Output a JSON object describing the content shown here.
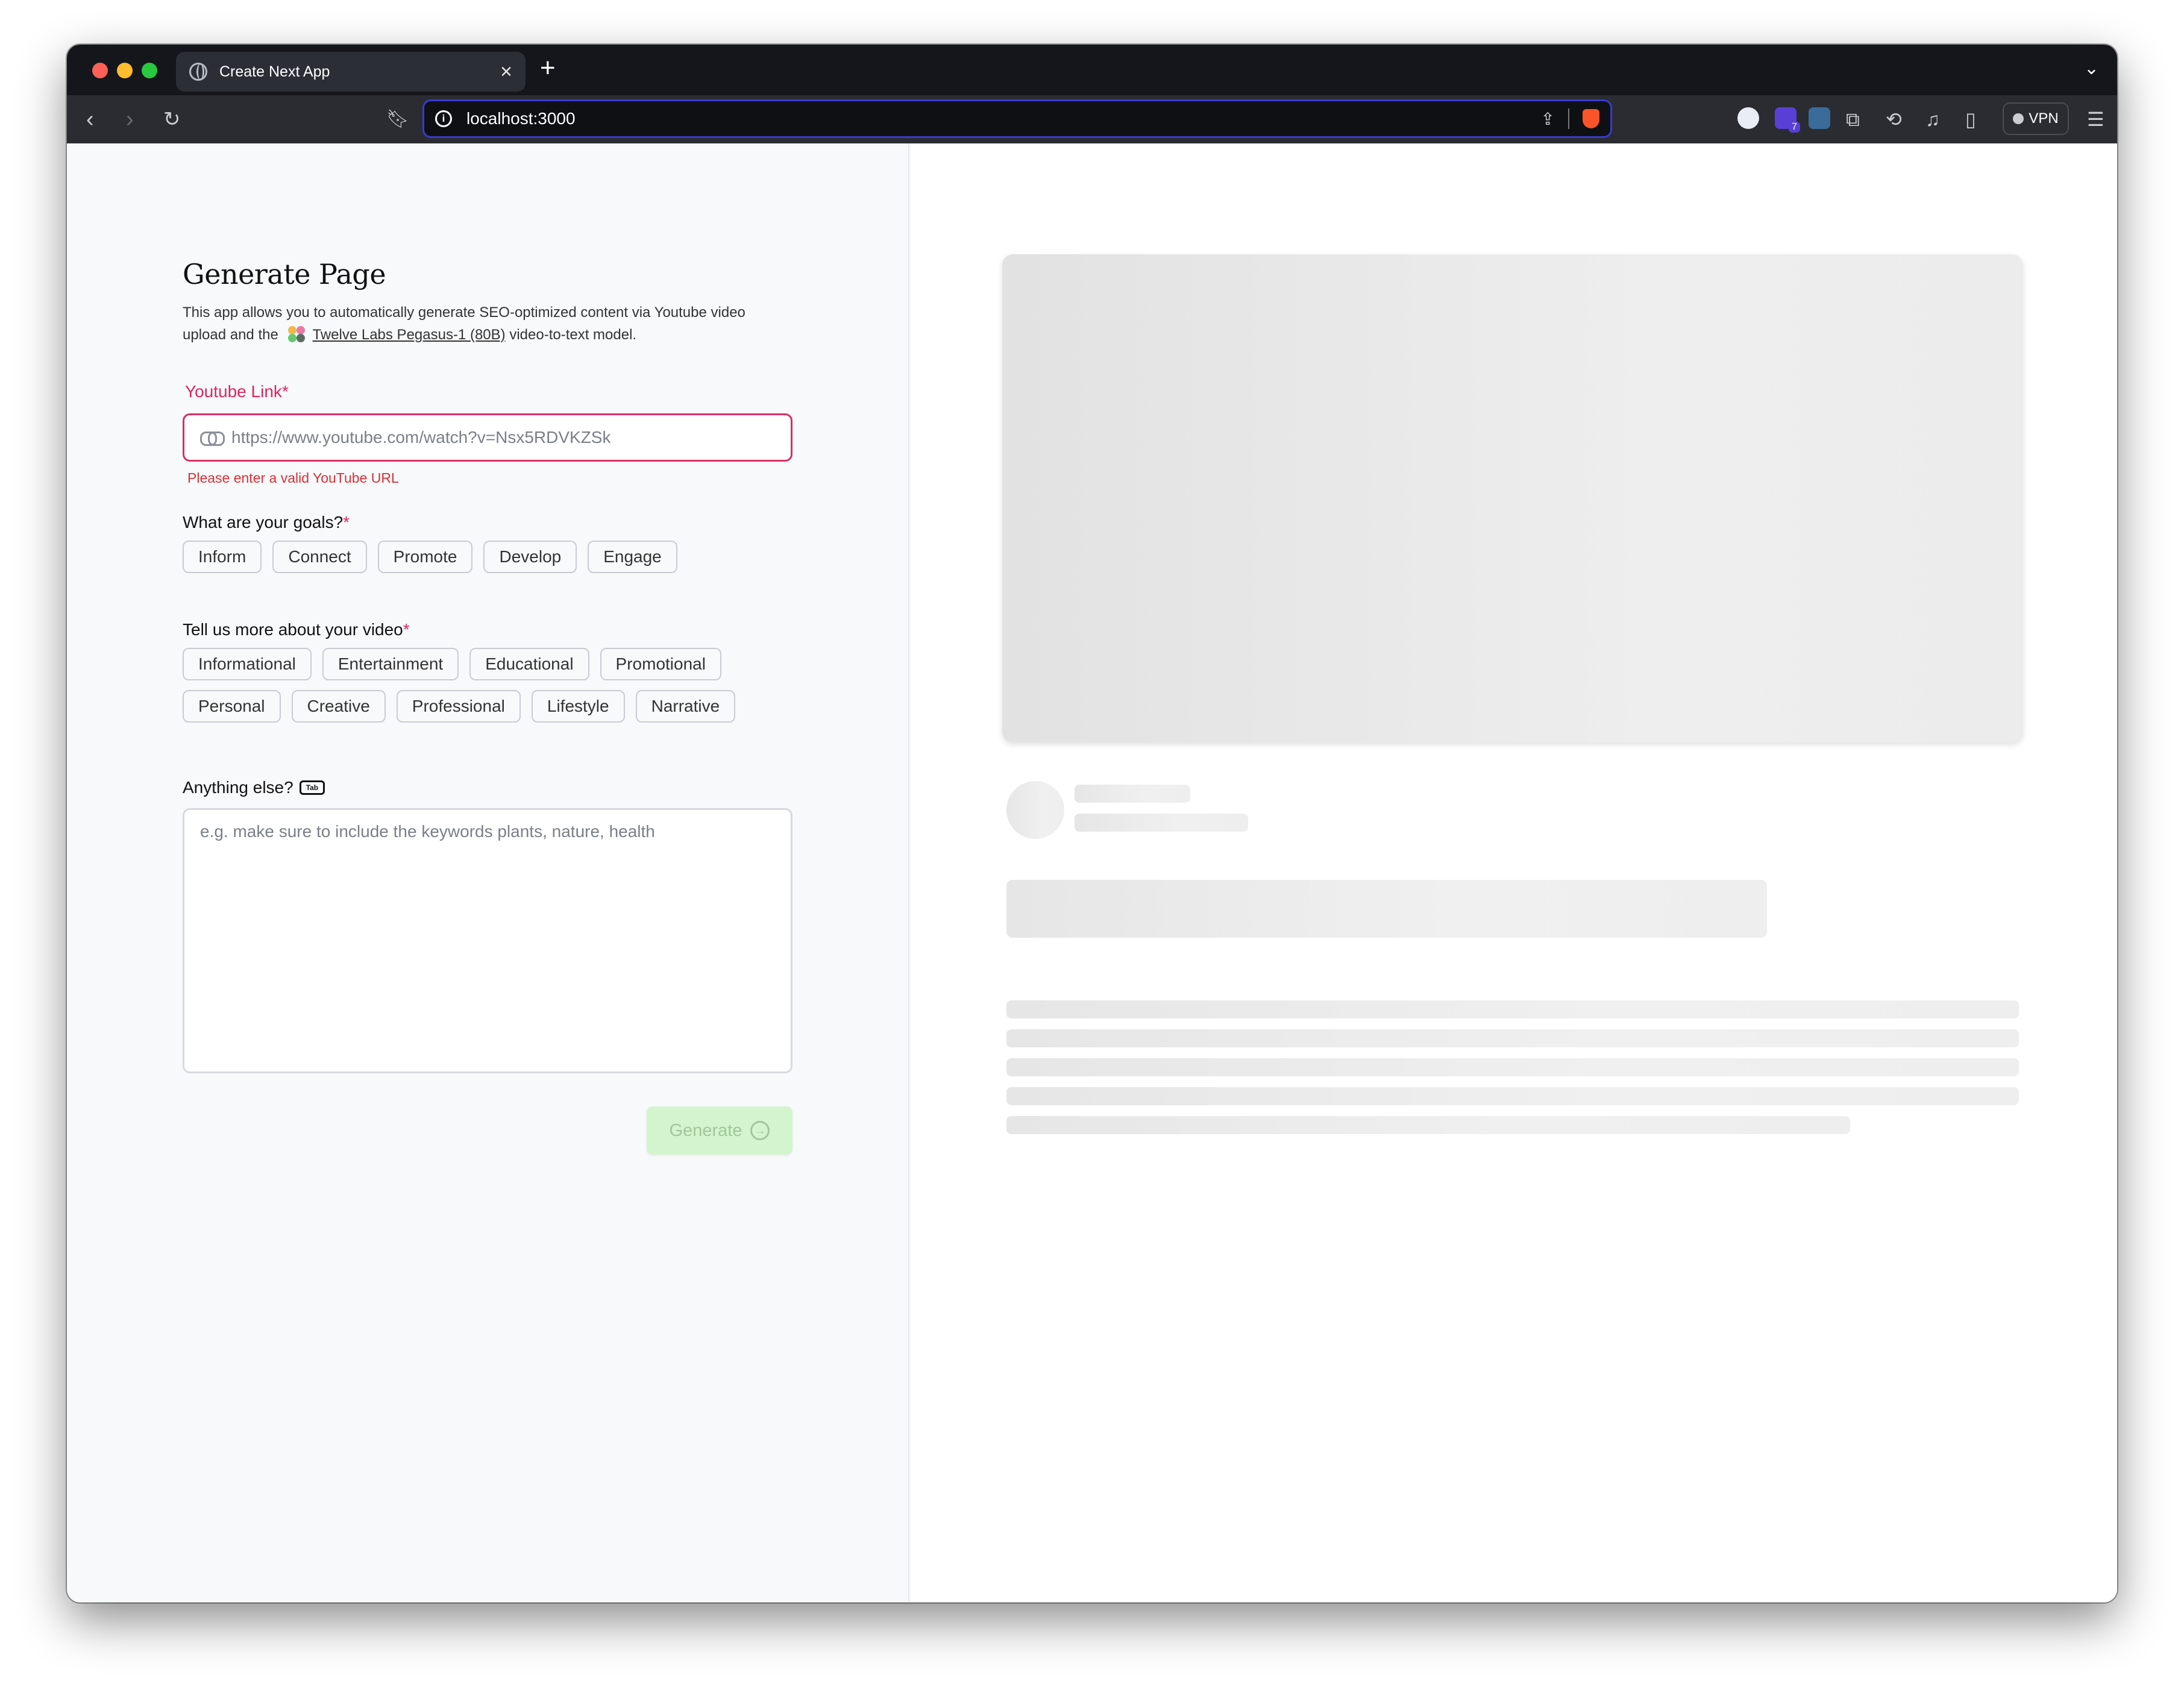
{
  "browser": {
    "tab_title": "Create Next App",
    "tab_close": "×",
    "new_tab": "+",
    "url": "localhost:3000",
    "extension_badge": "7",
    "vpn_label": "VPN"
  },
  "form": {
    "title": "Generate Page",
    "description_before": "This app allows you to automatically generate SEO-optimized content via Youtube video upload and the",
    "model_link": "Twelve Labs Pegasus-1 (80B)",
    "description_after": "video-to-text model.",
    "youtube_label": "Youtube Link",
    "required_mark": "*",
    "youtube_placeholder": "https://www.youtube.com/watch?v=Nsx5RDVKZSk",
    "youtube_error": "Please enter a valid YouTube URL",
    "goals_label": "What are your goals?",
    "goals": [
      "Inform",
      "Connect",
      "Promote",
      "Develop",
      "Engage"
    ],
    "video_label": "Tell us more about your video",
    "video_types": [
      "Informational",
      "Entertainment",
      "Educational",
      "Promotional",
      "Personal",
      "Creative",
      "Professional",
      "Lifestyle",
      "Narrative"
    ],
    "else_label": "Anything else?",
    "tab_hint": "Tab",
    "else_placeholder": "e.g. make sure to include the keywords plants, nature, health",
    "generate_label": "Generate"
  },
  "colors": {
    "accent_error": "#d92d63",
    "generate_bg": "#d3f5cd"
  }
}
